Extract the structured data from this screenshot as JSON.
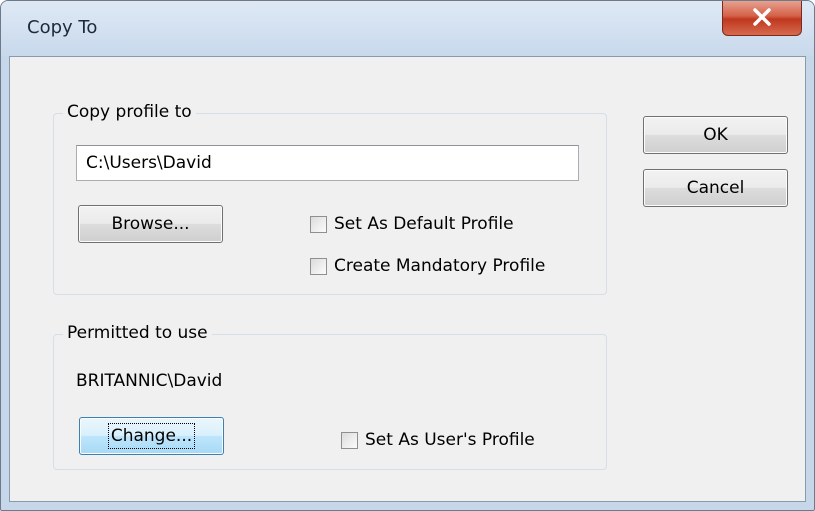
{
  "window": {
    "title": "Copy To",
    "close_icon": "close-icon"
  },
  "copy_profile": {
    "label": "Copy profile to",
    "path_value": "C:\\Users\\David",
    "browse_label": "Browse...",
    "default_checkbox_label": "Set As Default Profile",
    "default_checked": false,
    "mandatory_checkbox_label": "Create Mandatory Profile",
    "mandatory_checked": false
  },
  "permitted": {
    "label": "Permitted to use",
    "user": "BRITANNIC\\David",
    "change_label": "Change...",
    "user_profile_checkbox_label": "Set As User's Profile",
    "user_profile_checked": false
  },
  "buttons": {
    "ok": "OK",
    "cancel": "Cancel"
  },
  "colors": {
    "close_button": "#c8452d",
    "focus_border": "#3c7fb1"
  }
}
